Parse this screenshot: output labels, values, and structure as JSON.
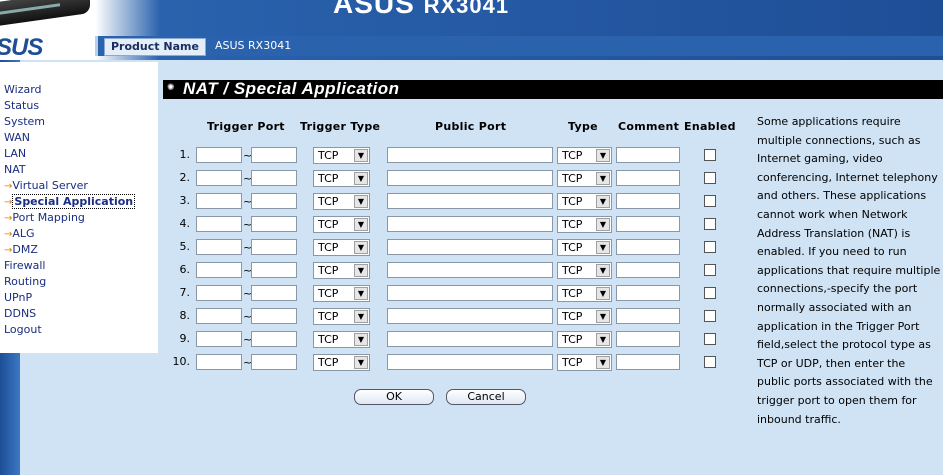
{
  "header": {
    "model_title": "ASUS",
    "model_sub": "RX3041",
    "logo": "SUS"
  },
  "product": {
    "label": "Product Name",
    "value": "ASUS RX3041"
  },
  "menu": {
    "items": [
      {
        "label": "Wizard",
        "sub": false,
        "active": false
      },
      {
        "label": "Status",
        "sub": false,
        "active": false
      },
      {
        "label": "System",
        "sub": false,
        "active": false
      },
      {
        "label": "WAN",
        "sub": false,
        "active": false
      },
      {
        "label": "LAN",
        "sub": false,
        "active": false
      },
      {
        "label": "NAT",
        "sub": false,
        "active": false
      },
      {
        "label": "Virtual Server",
        "sub": true,
        "active": false
      },
      {
        "label": "Special Application",
        "sub": true,
        "active": true
      },
      {
        "label": "Port Mapping",
        "sub": true,
        "active": false
      },
      {
        "label": "ALG",
        "sub": true,
        "active": false
      },
      {
        "label": "DMZ",
        "sub": true,
        "active": false
      },
      {
        "label": "Firewall",
        "sub": false,
        "active": false
      },
      {
        "label": "Routing",
        "sub": false,
        "active": false
      },
      {
        "label": "UPnP",
        "sub": false,
        "active": false
      },
      {
        "label": "DDNS",
        "sub": false,
        "active": false
      },
      {
        "label": "Logout",
        "sub": false,
        "active": false
      }
    ],
    "arrow": "→"
  },
  "page_title": "NAT / Special Application",
  "table": {
    "headers": {
      "trigger_port": "Trigger Port",
      "trigger_type": "Trigger Type",
      "public_port": "Public Port",
      "type": "Type",
      "comment": "Comment",
      "enabled": "Enabled"
    },
    "tilde": "~",
    "rows": [
      {
        "num": "1.",
        "trigger_type": "TCP",
        "type": "TCP",
        "enabled": false
      },
      {
        "num": "2.",
        "trigger_type": "TCP",
        "type": "TCP",
        "enabled": false
      },
      {
        "num": "3.",
        "trigger_type": "TCP",
        "type": "TCP",
        "enabled": false
      },
      {
        "num": "4.",
        "trigger_type": "TCP",
        "type": "TCP",
        "enabled": false
      },
      {
        "num": "5.",
        "trigger_type": "TCP",
        "type": "TCP",
        "enabled": false
      },
      {
        "num": "6.",
        "trigger_type": "TCP",
        "type": "TCP",
        "enabled": false
      },
      {
        "num": "7.",
        "trigger_type": "TCP",
        "type": "TCP",
        "enabled": false
      },
      {
        "num": "8.",
        "trigger_type": "TCP",
        "type": "TCP",
        "enabled": false
      },
      {
        "num": "9.",
        "trigger_type": "TCP",
        "type": "TCP",
        "enabled": false
      },
      {
        "num": "10.",
        "trigger_type": "TCP",
        "type": "TCP",
        "enabled": false
      }
    ]
  },
  "buttons": {
    "ok": "OK",
    "cancel": "Cancel"
  },
  "help_lines": [
    "Some applications require",
    "multiple connections, such as",
    "Internet gaming, video",
    "conferencing, Internet telephony",
    "and others. These applications",
    "cannot work when Network",
    "Address Translation (NAT) is",
    "enabled. If you need to run",
    "applications that require multiple",
    "connections,-specify the port",
    "normally associated with an",
    "application in the Trigger Port",
    "field,select the protocol type as",
    "TCP or UDP, then enter the",
    "public ports associated with the",
    "trigger port to open them for",
    "inbound traffic."
  ],
  "icons": {
    "dropdown": "chevron-down-icon",
    "title_bullet": "bullet-icon"
  },
  "colors": {
    "banner_blue": "#1e4e96",
    "page_bg": "#cfe3f5",
    "title_bar": "#000000",
    "menu_text": "#1a2d80"
  }
}
